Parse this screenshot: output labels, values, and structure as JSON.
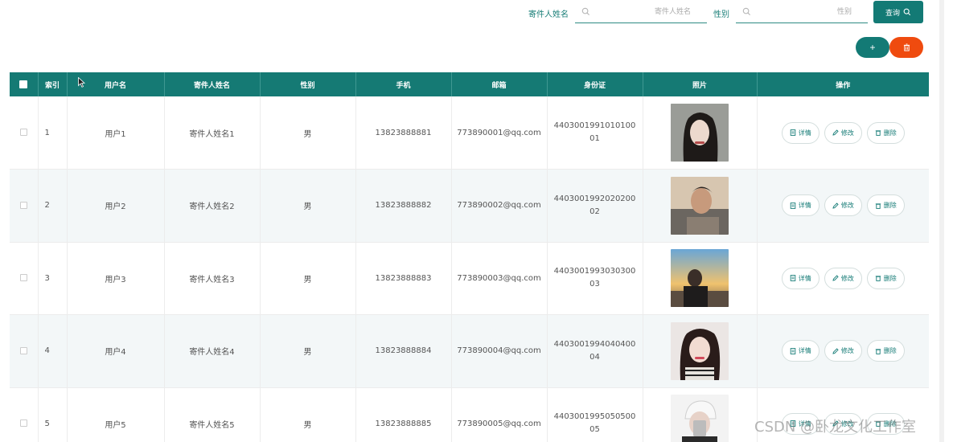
{
  "search": {
    "sender_label": "寄件人姓名",
    "sender_placeholder": "寄件人姓名",
    "gender_label": "性别",
    "gender_placeholder": "性别",
    "query_label": "查询"
  },
  "toolbar": {
    "add_label": "+"
  },
  "table": {
    "headers": [
      "索引",
      "用户名",
      "寄件人姓名",
      "性别",
      "手机",
      "邮箱",
      "身份证",
      "照片",
      "操作"
    ],
    "actions": {
      "detail": "详情",
      "edit": "修改",
      "delete": "删除"
    },
    "rows": [
      {
        "index": "1",
        "username": "用户1",
        "sender": "寄件人姓名1",
        "gender": "男",
        "phone": "13823888881",
        "email": "773890001@qq.com",
        "idcard": "440300199101010001"
      },
      {
        "index": "2",
        "username": "用户2",
        "sender": "寄件人姓名2",
        "gender": "男",
        "phone": "13823888882",
        "email": "773890002@qq.com",
        "idcard": "440300199202020002"
      },
      {
        "index": "3",
        "username": "用户3",
        "sender": "寄件人姓名3",
        "gender": "男",
        "phone": "13823888883",
        "email": "773890003@qq.com",
        "idcard": "440300199303030003"
      },
      {
        "index": "4",
        "username": "用户4",
        "sender": "寄件人姓名4",
        "gender": "男",
        "phone": "13823888884",
        "email": "773890004@qq.com",
        "idcard": "440300199404040004"
      },
      {
        "index": "5",
        "username": "用户5",
        "sender": "寄件人姓名5",
        "gender": "男",
        "phone": "13823888885",
        "email": "773890005@qq.com",
        "idcard": "440300199505050005"
      }
    ]
  },
  "watermark": "CSDN @卧龙文化工作室",
  "colors": {
    "primary": "#157a74",
    "danger": "#ef4b0f"
  }
}
